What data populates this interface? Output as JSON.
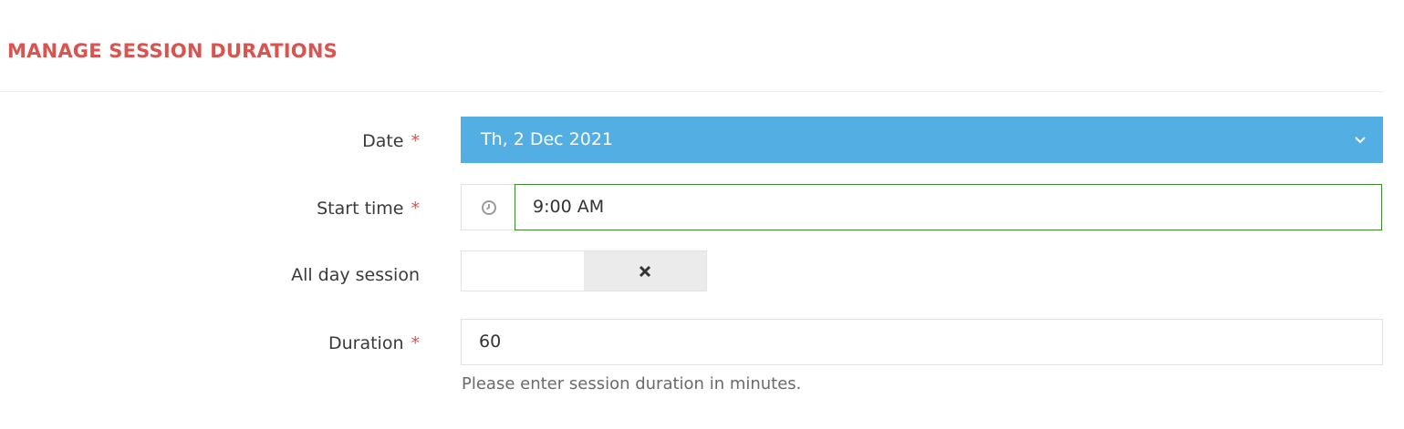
{
  "page": {
    "title": "MANAGE SESSION DURATIONS"
  },
  "form": {
    "date": {
      "label": "Date",
      "required_mark": "*",
      "value": "Th, 2 Dec 2021",
      "icon": "chevron-down-icon"
    },
    "start_time": {
      "label": "Start time",
      "required_mark": "*",
      "value": "9:00 AM",
      "icon": "clock-icon"
    },
    "all_day": {
      "label": "All day session",
      "state": "off",
      "icon": "close-icon"
    },
    "duration": {
      "label": "Duration",
      "required_mark": "*",
      "value": "60",
      "help": "Please enter session duration in minutes."
    }
  },
  "colors": {
    "title": "#d9534f",
    "date_select_bg": "#53aee3",
    "required": "#d9534f",
    "focus_border": "#3c8a2e"
  }
}
